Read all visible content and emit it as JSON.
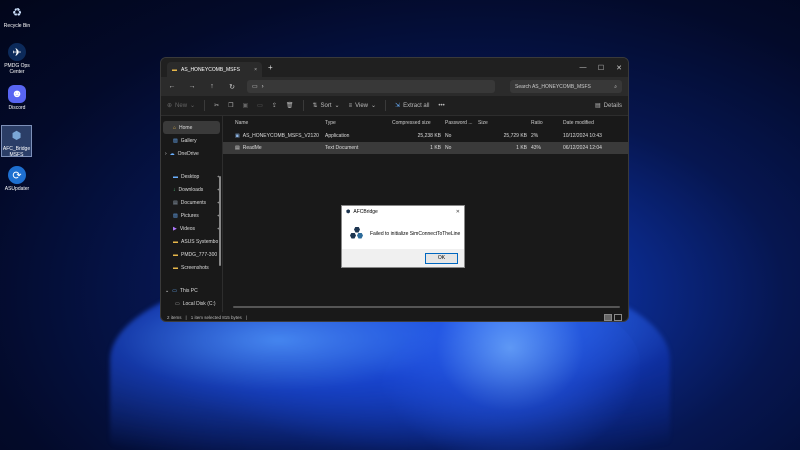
{
  "desktop": {
    "icons": [
      {
        "label": "Recycle Bin",
        "icon": "recycle-bin-icon"
      },
      {
        "label": "PMDG Ops Center",
        "icon": "pmdg-icon"
      },
      {
        "label": "Discord",
        "icon": "discord-icon"
      },
      {
        "label": "AFC_Bridge MSFS",
        "icon": "afc-bridge-icon"
      },
      {
        "label": "ASUpdater",
        "icon": "asupdater-icon"
      }
    ]
  },
  "window": {
    "tab_title": "AS_HONEYCOMB_MSFS",
    "tab_close": "×",
    "new_tab": "+",
    "controls": {
      "minimize": "—",
      "maximize": "☐",
      "close": "✕"
    },
    "address": {
      "path_chevron": "›"
    },
    "search_placeholder": "Search AS_HONEYCOMB_MSFS",
    "toolbar": {
      "new_label": "New",
      "sort_label": "Sort",
      "view_label": "View",
      "extract_label": "Extract all",
      "more_label": "•••",
      "details_label": "Details"
    },
    "nav": {
      "home": "Home",
      "gallery": "Gallery",
      "onedrive": "OneDrive",
      "desktop": "Desktop",
      "downloads": "Downloads",
      "documents": "Documents",
      "pictures": "Pictures",
      "videos": "Videos",
      "asus": "ASUS Systembo",
      "pmdg": "PMDG_777-300",
      "screenshots": "Screenshots",
      "thispc": "This PC",
      "localdisk": "Local Disk (C:)"
    },
    "columns": {
      "name": "Name",
      "type": "Type",
      "compressed": "Compressed size",
      "password": "Password ...",
      "size": "Size",
      "ratio": "Ratio",
      "date": "Date modified"
    },
    "files": [
      {
        "name": "AS_HONEYCOMB_MSFS_V2120",
        "type": "Application",
        "compressed": "25,238 KB",
        "password": "No",
        "size": "25,729 KB",
        "ratio": "2%",
        "date": "10/12/2024 10:43"
      },
      {
        "name": "ReadMe",
        "type": "Text Document",
        "compressed": "1 KB",
        "password": "No",
        "size": "1 KB",
        "ratio": "43%",
        "date": "06/12/2024 12:04"
      }
    ],
    "status": {
      "items": "2 items",
      "selected": "1 item selected  815 bytes"
    }
  },
  "dialog": {
    "title": "AFCBridge",
    "close": "✕",
    "message": "Failed to initialize SimConnectToTheLine",
    "ok_label": "OK"
  }
}
